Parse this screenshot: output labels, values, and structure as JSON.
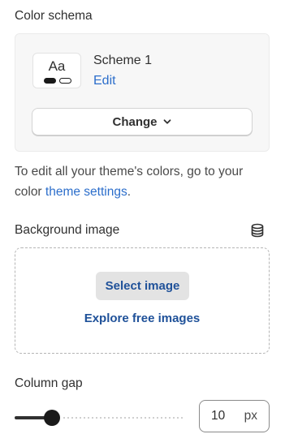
{
  "color_scheme": {
    "label": "Color schema",
    "preview_text": "Aa",
    "scheme_name": "Scheme 1",
    "edit_label": "Edit",
    "change_label": "Change",
    "help_text_prefix": "To edit all your theme's colors, go to your color ",
    "help_link": "theme settings",
    "help_text_suffix": "."
  },
  "background_image": {
    "label": "Background image",
    "label_icon": "database-icon",
    "select_label": "Select image",
    "explore_label": "Explore free images"
  },
  "column_gap": {
    "label": "Column gap",
    "value": "10",
    "unit": "px",
    "slider_fraction": 0.22
  },
  "colors": {
    "link": "#2c6ecb",
    "link_strong": "#1f5199",
    "text": "#303030"
  }
}
